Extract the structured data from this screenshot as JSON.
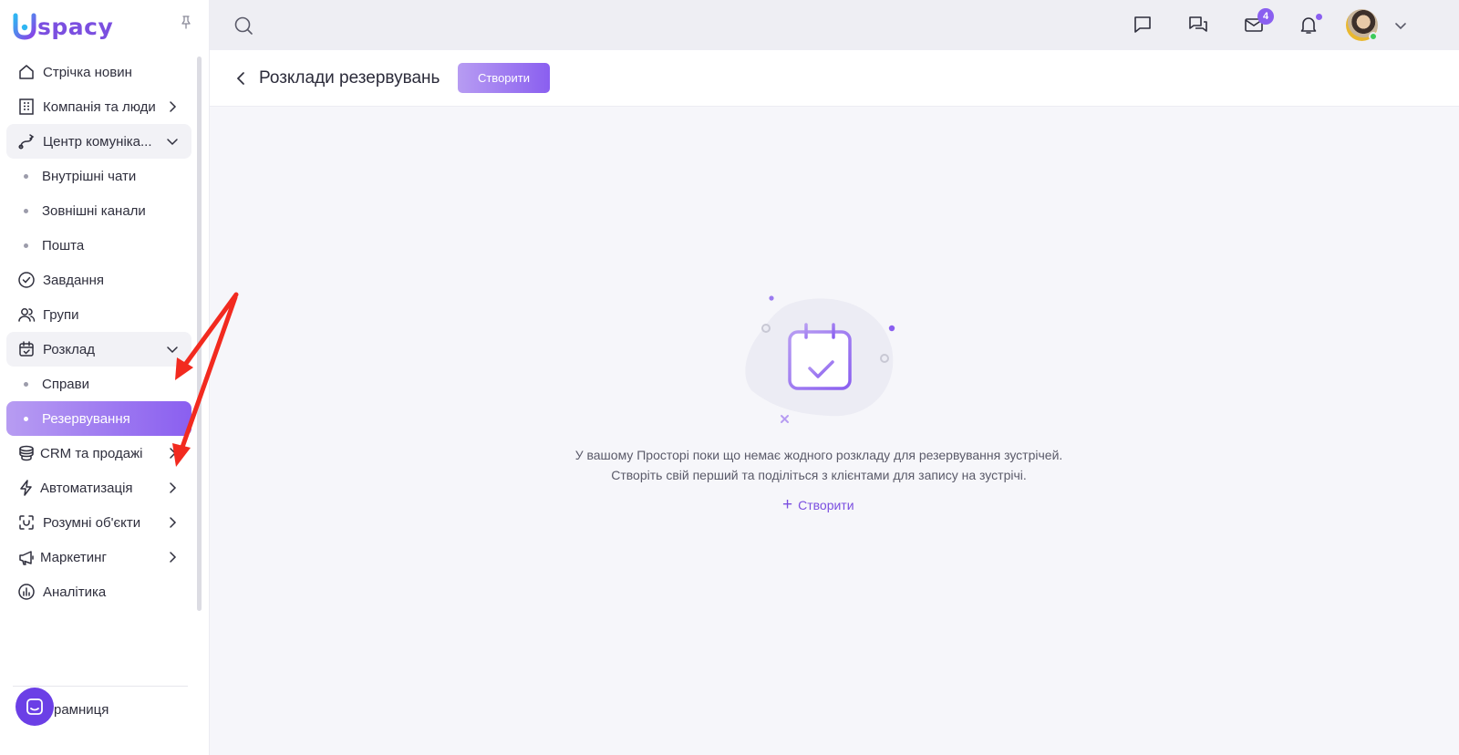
{
  "brand": {
    "logo_text": "spacy"
  },
  "sidebar": {
    "items": [
      {
        "id": "news",
        "label": "Стрічка новин",
        "icon": "home-icon",
        "chevron": ""
      },
      {
        "id": "company",
        "label": "Компанія та люди",
        "icon": "building-icon",
        "chevron": "right"
      },
      {
        "id": "comm",
        "label": "Центр комуніка...",
        "icon": "communication-icon",
        "chevron": "down",
        "open": true,
        "children": [
          {
            "label": "Внутрішні чати"
          },
          {
            "label": "Зовнішні канали"
          },
          {
            "label": "Пошта"
          }
        ]
      },
      {
        "id": "tasks",
        "label": "Завдання",
        "icon": "check-circle-icon",
        "chevron": ""
      },
      {
        "id": "groups",
        "label": "Групи",
        "icon": "users-icon",
        "chevron": ""
      },
      {
        "id": "schedule",
        "label": "Розклад",
        "icon": "calendar-check-icon",
        "chevron": "down",
        "open": true,
        "children": [
          {
            "label": "Справи"
          },
          {
            "label": "Резервування",
            "active": true
          }
        ]
      },
      {
        "id": "crm",
        "label": "CRM та продажі",
        "icon": "coins-icon",
        "chevron": "right"
      },
      {
        "id": "automation",
        "label": "Автоматизація",
        "icon": "lightning-icon",
        "chevron": "right"
      },
      {
        "id": "smart",
        "label": "Розумні об'єкти",
        "icon": "scan-icon",
        "chevron": "right"
      },
      {
        "id": "marketing",
        "label": "Маркетинг",
        "icon": "megaphone-icon",
        "chevron": "right"
      },
      {
        "id": "analytics",
        "label": "Аналітика",
        "icon": "chart-icon",
        "chevron": ""
      }
    ],
    "bottom_item": "рамниця"
  },
  "topbar": {
    "mail_badge": "4",
    "icons": [
      "search-icon",
      "chat-icon",
      "messages-icon",
      "mail-icon",
      "bell-icon",
      "avatar",
      "chevron-down-icon"
    ]
  },
  "page": {
    "title": "Розклади резервувань",
    "create_button": "Створити"
  },
  "empty_state": {
    "line1": "У вашому Просторі поки що немає жодного розкладу для резервування зустрічей.",
    "line2": "Створіть свій перший та поділіться з клієнтами для запису на зустрічі.",
    "link": "Створити"
  },
  "colors": {
    "accent": "#8a5ff0",
    "accent_light": "#b79cf2",
    "fab": "#6b3fe6",
    "annotation_arrow": "#f22a1f"
  }
}
